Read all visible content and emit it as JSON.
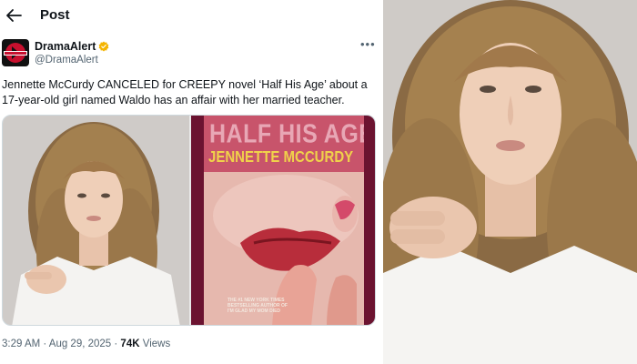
{
  "header": {
    "title": "Post",
    "back_icon": "arrow-left-icon"
  },
  "author": {
    "display_name": "DramaAlert",
    "handle": "@DramaAlert",
    "verified_color": "#f4b400",
    "avatar_icon": "dramaalert-logo"
  },
  "more_icon": "ellipsis-icon",
  "tweet": {
    "text": "Jennette McCurdy CANCELED for CREEPY novel ‘Half His Age’ about a 17-year-old girl named Waldo has an affair with her married teacher."
  },
  "book_cover": {
    "title": "HALF HIS AGE",
    "author": "JENNETTE MCCURDY",
    "blurb_line1": "THE #1 NEW YORK TIMES",
    "blurb_line2": "BESTSELLING AUTHOR OF",
    "blurb_line3": "I'M GLAD MY MOM DIED"
  },
  "meta": {
    "time": "3:29 AM · Aug 29, 2025 · ",
    "views_count": "74K",
    "views_label": " Views"
  }
}
